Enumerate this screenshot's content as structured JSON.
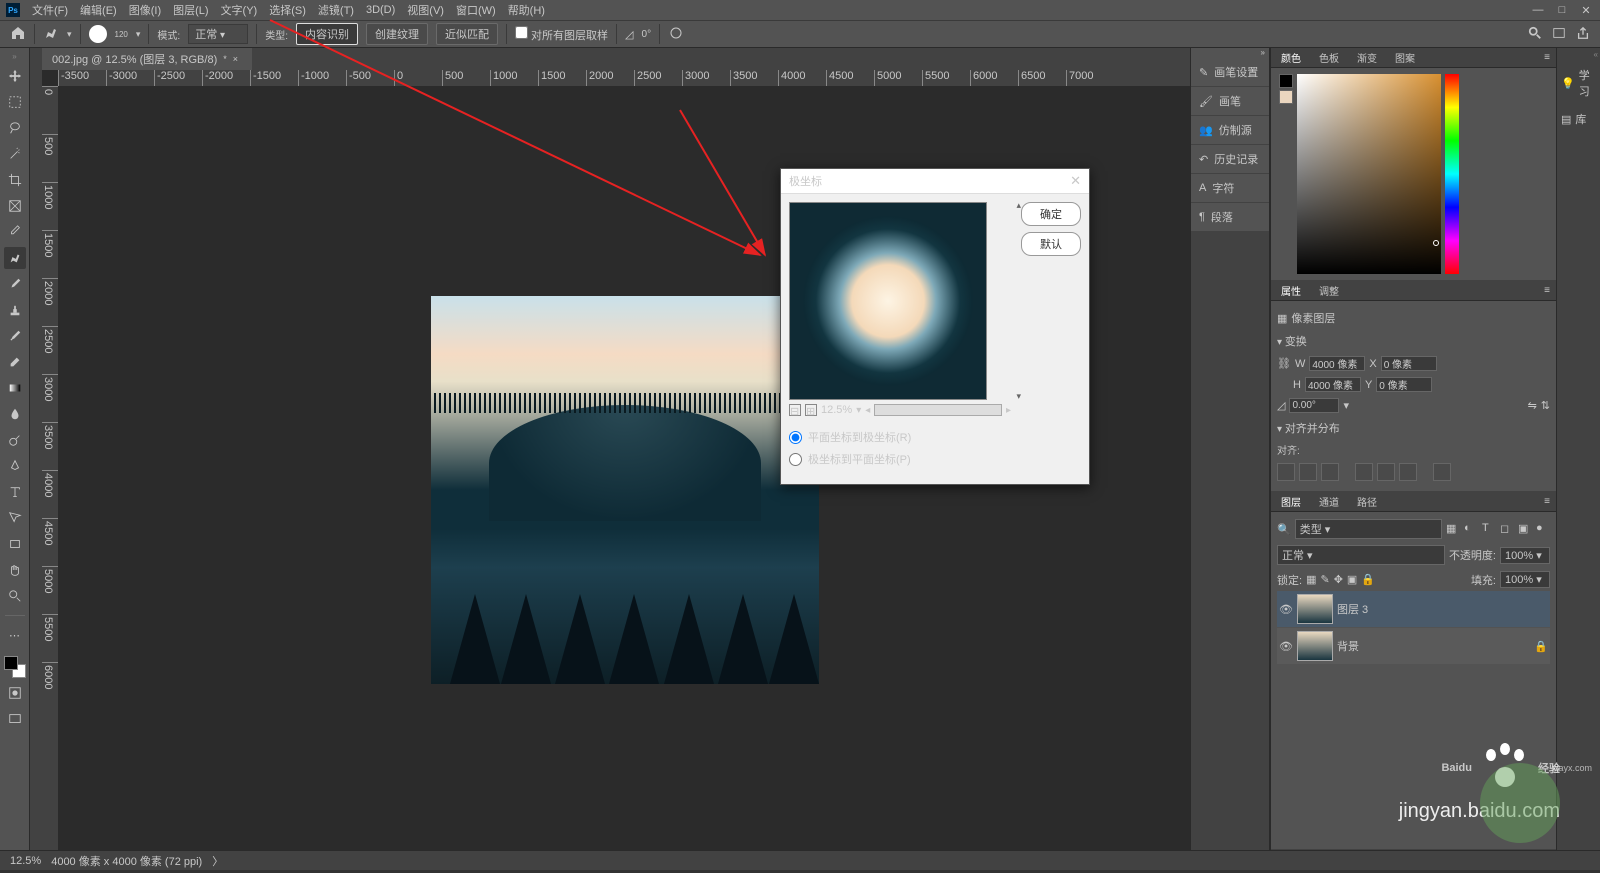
{
  "menubar": {
    "logo": "Ps",
    "items": [
      "文件(F)",
      "编辑(E)",
      "图像(I)",
      "图层(L)",
      "文字(Y)",
      "选择(S)",
      "滤镜(T)",
      "3D(D)",
      "视图(V)",
      "窗口(W)",
      "帮助(H)"
    ]
  },
  "optionsbar": {
    "brush_size": "120",
    "mode_label": "模式:",
    "mode_value": "正常",
    "type_label": "类型:",
    "type1": "内容识别",
    "type2": "创建纹理",
    "type3": "近似匹配",
    "sample_all": "对所有图层取样",
    "angle_icon": "◿",
    "angle_value": "0°"
  },
  "doc_tab": {
    "title": "002.jpg @ 12.5% (图层 3, RGB/8)",
    "modified": "*"
  },
  "ruler_h": [
    "-3500",
    "-3000",
    "-2500",
    "-2000",
    "-1500",
    "-1000",
    "-500",
    "0",
    "500",
    "1000",
    "1500",
    "2000",
    "2500",
    "3000",
    "3500",
    "4000",
    "4500",
    "5000",
    "5500",
    "6000",
    "6500",
    "7000"
  ],
  "ruler_v": [
    "0",
    "500",
    "1000",
    "1500",
    "2000",
    "2500",
    "3000",
    "3500",
    "4000",
    "4500",
    "5000",
    "5500",
    "6000"
  ],
  "left_panels": {
    "items": [
      "画笔设置",
      "画笔",
      "仿制源",
      "历史记录",
      "字符",
      "段落"
    ]
  },
  "right_collapsed": {
    "learn": "学习",
    "library": "库"
  },
  "color_panel": {
    "tabs": [
      "颜色",
      "色板",
      "渐变",
      "图案"
    ],
    "fg": "#000000",
    "bg": "#ead6bf"
  },
  "properties_panel": {
    "tabs": [
      "属性",
      "调整"
    ],
    "doc_label": "像素图层",
    "transform_label": "变换",
    "w_label": "W",
    "w_value": "4000 像素",
    "x_label": "X",
    "x_value": "0 像素",
    "h_label": "H",
    "h_value": "4000 像素",
    "y_label": "Y",
    "y_value": "0 像素",
    "angle": "0.00°",
    "align_label": "对齐并分布",
    "align_sub": "对齐:"
  },
  "layers_panel": {
    "tabs": [
      "图层",
      "通道",
      "路径"
    ],
    "kind_label": "类型",
    "blend_mode": "正常",
    "opacity_label": "不透明度:",
    "opacity_value": "100%",
    "lock_label": "锁定:",
    "fill_label": "填充:",
    "fill_value": "100%",
    "layers": [
      {
        "name": "图层 3"
      },
      {
        "name": "背景"
      }
    ]
  },
  "dialog": {
    "title": "极坐标",
    "ok": "确定",
    "cancel": "默认",
    "zoom": "12.5%",
    "option1": "平面坐标到极坐标(R)",
    "option2": "极坐标到平面坐标(P)"
  },
  "statusbar": {
    "zoom": "12.5%",
    "doc_info": "4000 像素 x 4000 像素 (72 ppi)"
  },
  "watermark": {
    "brand": "Baidu",
    "text": "经验",
    "url": "jingyan.baidu.com",
    "small": "xiayx.com"
  }
}
